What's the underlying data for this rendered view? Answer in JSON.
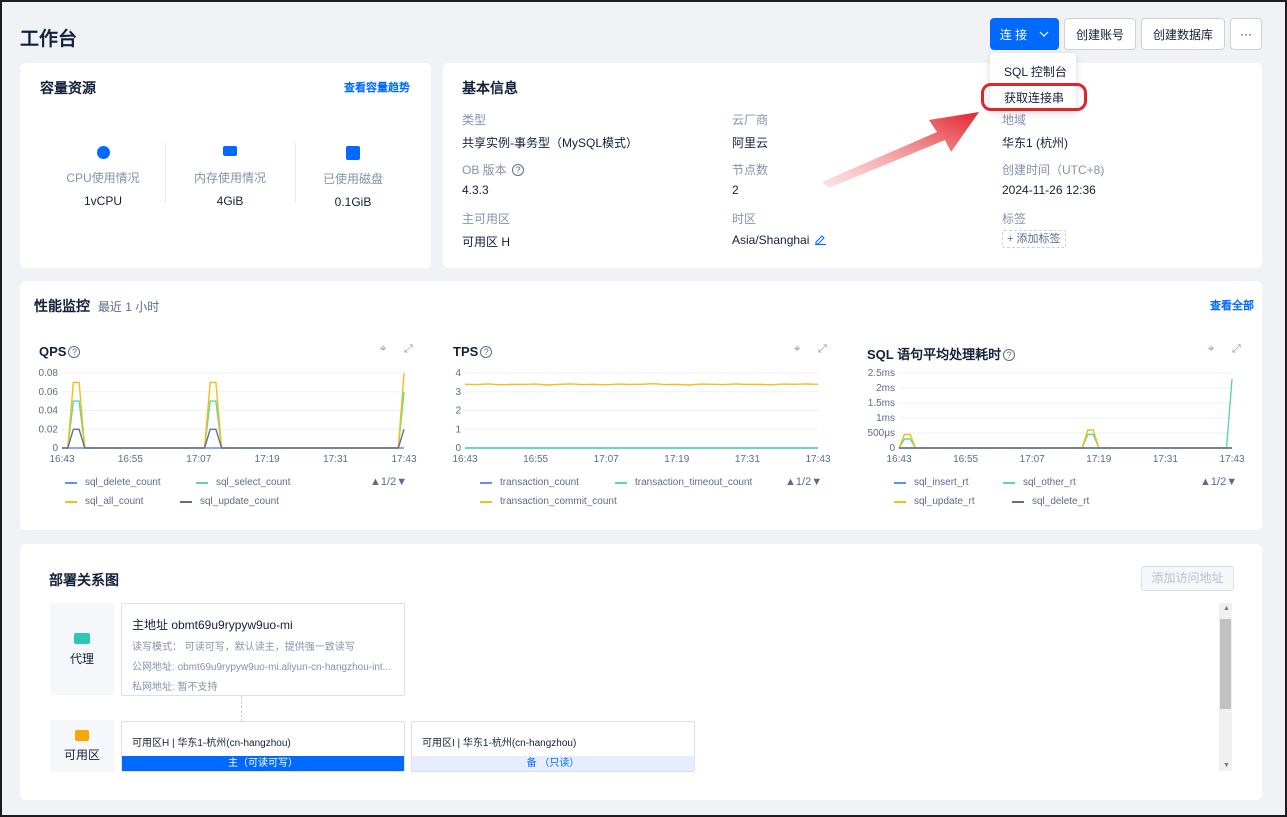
{
  "header": {
    "title": "工作台",
    "connect_label": "连 接",
    "create_account_label": "创建账号",
    "create_db_label": "创建数据库",
    "more_label": "···"
  },
  "connect_menu": {
    "items": [
      "SQL 控制台",
      "获取连接串"
    ]
  },
  "capacity": {
    "title": "容量资源",
    "trend_link": "查看容量趋势",
    "items": [
      {
        "label": "CPU使用情况",
        "value": "1vCPU",
        "icon": "cpu-icon"
      },
      {
        "label": "内存使用情况",
        "value": "4GiB",
        "icon": "memory-icon"
      },
      {
        "label": "已使用磁盘",
        "value": "0.1GiB",
        "icon": "disk-icon"
      }
    ]
  },
  "basic_info": {
    "title": "基本信息",
    "fields": [
      {
        "label": "类型",
        "value": "共享实例-事务型（MySQL模式）"
      },
      {
        "label": "云厂商",
        "value": "阿里云"
      },
      {
        "label": "地域",
        "value": "华东1 (杭州)"
      },
      {
        "label": "OB 版本",
        "value": "4.3.3"
      },
      {
        "label": "节点数",
        "value": "2"
      },
      {
        "label": "创建时间（UTC+8)",
        "value": "2024-11-26 12:36"
      },
      {
        "label": "主可用区",
        "value": "可用区 H"
      },
      {
        "label": "时区",
        "value": "Asia/Shanghai"
      },
      {
        "label": "标签",
        "value": "添加标签"
      }
    ]
  },
  "performance": {
    "title": "性能监控",
    "subtitle": "最近 1 小时",
    "view_all": "查看全部",
    "pager": "1/2"
  },
  "chart_data": [
    {
      "type": "line",
      "title": "QPS",
      "x_ticks": [
        "16:43",
        "16:55",
        "17:07",
        "17:19",
        "17:31",
        "17:43"
      ],
      "y_ticks": [
        "0",
        "0.02",
        "0.04",
        "0.06",
        "0.08"
      ],
      "ylim": [
        0,
        0.08
      ],
      "x": [
        0,
        1,
        2,
        3,
        4,
        5,
        6,
        7,
        8,
        9,
        10,
        11,
        12,
        13,
        14,
        15,
        16,
        17,
        18,
        19,
        20,
        21,
        22,
        23,
        24,
        25,
        26,
        27,
        28,
        29,
        30,
        31,
        32,
        33,
        34,
        35,
        36,
        37,
        38,
        39,
        40,
        41,
        42,
        43,
        44,
        45,
        46,
        47,
        48,
        49,
        50,
        51,
        52,
        53,
        54,
        55,
        56,
        57,
        58,
        59,
        60
      ],
      "series": [
        {
          "name": "sql_delete_count",
          "color": "#5b8ff9",
          "values": [
            0,
            0,
            0,
            0,
            0,
            0,
            0,
            0,
            0,
            0,
            0,
            0,
            0,
            0,
            0,
            0,
            0,
            0,
            0,
            0,
            0,
            0,
            0,
            0,
            0,
            0,
            0,
            0,
            0,
            0,
            0,
            0,
            0,
            0,
            0,
            0,
            0,
            0,
            0,
            0,
            0,
            0,
            0,
            0,
            0,
            0,
            0,
            0,
            0,
            0,
            0,
            0,
            0,
            0,
            0,
            0,
            0,
            0,
            0,
            0,
            0
          ]
        },
        {
          "name": "sql_select_count",
          "color": "#5ad8a6",
          "values": [
            0,
            0,
            0.05,
            0.05,
            0,
            0,
            0,
            0,
            0,
            0,
            0,
            0,
            0,
            0,
            0,
            0,
            0,
            0,
            0,
            0,
            0,
            0,
            0,
            0,
            0,
            0,
            0.05,
            0.05,
            0,
            0,
            0,
            0,
            0,
            0,
            0,
            0,
            0,
            0,
            0,
            0,
            0,
            0,
            0,
            0,
            0,
            0,
            0,
            0,
            0,
            0,
            0,
            0,
            0,
            0,
            0,
            0,
            0,
            0,
            0,
            0,
            0.06
          ]
        },
        {
          "name": "sql_all_count",
          "color": "#f6bd16",
          "values": [
            0,
            0,
            0.07,
            0.07,
            0,
            0,
            0,
            0,
            0,
            0,
            0,
            0,
            0,
            0,
            0,
            0,
            0,
            0,
            0,
            0,
            0,
            0,
            0,
            0,
            0,
            0,
            0.07,
            0.07,
            0,
            0,
            0,
            0,
            0,
            0,
            0,
            0,
            0,
            0,
            0,
            0,
            0,
            0,
            0,
            0,
            0,
            0,
            0,
            0,
            0,
            0,
            0,
            0,
            0,
            0,
            0,
            0,
            0,
            0,
            0,
            0,
            0.08
          ]
        },
        {
          "name": "sql_update_count",
          "color": "#5d7092",
          "values": [
            0,
            0,
            0.02,
            0.02,
            0,
            0,
            0,
            0,
            0,
            0,
            0,
            0,
            0,
            0,
            0,
            0,
            0,
            0,
            0,
            0,
            0,
            0,
            0,
            0,
            0,
            0,
            0.02,
            0.02,
            0,
            0,
            0,
            0,
            0,
            0,
            0,
            0,
            0,
            0,
            0,
            0,
            0,
            0,
            0,
            0,
            0,
            0,
            0,
            0,
            0,
            0,
            0,
            0,
            0,
            0,
            0,
            0,
            0,
            0,
            0,
            0,
            0.02
          ]
        }
      ]
    },
    {
      "type": "line",
      "title": "TPS",
      "x_ticks": [
        "16:43",
        "16:55",
        "17:07",
        "17:19",
        "17:31",
        "17:43"
      ],
      "y_ticks": [
        "0",
        "1",
        "2",
        "3",
        "4"
      ],
      "ylim": [
        0,
        4
      ],
      "x": [
        0,
        1,
        2,
        3,
        4,
        5,
        6,
        7,
        8,
        9,
        10,
        11,
        12,
        13,
        14,
        15,
        16,
        17,
        18,
        19,
        20,
        21,
        22,
        23,
        24,
        25,
        26,
        27,
        28,
        29,
        30
      ],
      "series": [
        {
          "name": "transaction_count",
          "color": "#5b8ff9",
          "values": [
            0,
            0,
            0,
            0,
            0,
            0,
            0,
            0,
            0,
            0,
            0,
            0,
            0,
            0,
            0,
            0,
            0,
            0,
            0,
            0,
            0,
            0,
            0,
            0,
            0,
            0,
            0,
            0,
            0,
            0,
            0
          ]
        },
        {
          "name": "transaction_timeout_count",
          "color": "#5ad8a6",
          "values": [
            0,
            0,
            0,
            0,
            0,
            0,
            0,
            0,
            0,
            0,
            0,
            0,
            0,
            0,
            0,
            0,
            0,
            0,
            0,
            0,
            0,
            0,
            0,
            0,
            0,
            0,
            0,
            0,
            0,
            0,
            0
          ]
        },
        {
          "name": "transaction_commit_count",
          "color": "#f6bd16",
          "values": [
            3.4,
            3.38,
            3.42,
            3.37,
            3.4,
            3.39,
            3.41,
            3.36,
            3.4,
            3.42,
            3.38,
            3.4,
            3.37,
            3.41,
            3.39,
            3.4,
            3.43,
            3.38,
            3.4,
            3.36,
            3.41,
            3.4,
            3.38,
            3.42,
            3.39,
            3.4,
            3.37,
            3.41,
            3.4,
            3.42,
            3.4
          ]
        }
      ]
    },
    {
      "type": "line",
      "title": "SQL 语句平均处理耗时",
      "x_ticks": [
        "16:43",
        "16:55",
        "17:07",
        "17:19",
        "17:31",
        "17:43"
      ],
      "y_ticks": [
        "0",
        "500μs",
        "1ms",
        "1.5ms",
        "2ms",
        "2.5ms"
      ],
      "ylim": [
        0,
        2.5
      ],
      "x": [
        0,
        1,
        2,
        3,
        4,
        5,
        6,
        7,
        8,
        9,
        10,
        11,
        12,
        13,
        14,
        15,
        16,
        17,
        18,
        19,
        20,
        21,
        22,
        23,
        24,
        25,
        26,
        27,
        28,
        29,
        30,
        31,
        32,
        33,
        34,
        35,
        36,
        37,
        38,
        39,
        40,
        41,
        42,
        43,
        44,
        45,
        46,
        47,
        48,
        49,
        50,
        51,
        52,
        53,
        54,
        55,
        56,
        57,
        58,
        59,
        60
      ],
      "series": [
        {
          "name": "sql_insert_rt",
          "color": "#5b8ff9",
          "values": [
            0,
            0,
            0,
            0,
            0,
            0,
            0,
            0,
            0,
            0,
            0,
            0,
            0,
            0,
            0,
            0,
            0,
            0,
            0,
            0,
            0,
            0,
            0,
            0,
            0,
            0,
            0,
            0,
            0,
            0,
            0,
            0,
            0,
            0,
            0,
            0,
            0,
            0,
            0,
            0,
            0,
            0,
            0,
            0,
            0,
            0,
            0,
            0,
            0,
            0,
            0,
            0,
            0,
            0,
            0,
            0,
            0,
            0,
            0,
            0,
            0
          ]
        },
        {
          "name": "sql_other_rt",
          "color": "#5ad8a6",
          "values": [
            0,
            0.3,
            0.3,
            0,
            0,
            0,
            0,
            0,
            0,
            0,
            0,
            0,
            0,
            0,
            0,
            0,
            0,
            0,
            0,
            0,
            0,
            0,
            0,
            0,
            0,
            0,
            0,
            0,
            0,
            0,
            0,
            0,
            0,
            0,
            0.45,
            0.45,
            0,
            0,
            0,
            0,
            0,
            0,
            0,
            0,
            0,
            0,
            0,
            0,
            0,
            0,
            0,
            0,
            0,
            0,
            0,
            0,
            0,
            0,
            0,
            0,
            2.3
          ]
        },
        {
          "name": "sql_update_rt",
          "color": "#f6bd16",
          "values": [
            0,
            0.45,
            0.45,
            0,
            0,
            0,
            0,
            0,
            0,
            0,
            0,
            0,
            0,
            0,
            0,
            0,
            0,
            0,
            0,
            0,
            0,
            0,
            0,
            0,
            0,
            0,
            0,
            0,
            0,
            0,
            0,
            0,
            0,
            0,
            0.6,
            0.6,
            0,
            0,
            0,
            0,
            0,
            0,
            0,
            0,
            0,
            0,
            0,
            0,
            0,
            0,
            0,
            0,
            0,
            0,
            0,
            0,
            0,
            0,
            0,
            0,
            0
          ]
        },
        {
          "name": "sql_delete_rt",
          "color": "#5d7092",
          "values": [
            0,
            0,
            0,
            0,
            0,
            0,
            0,
            0,
            0,
            0,
            0,
            0,
            0,
            0,
            0,
            0,
            0,
            0,
            0,
            0,
            0,
            0,
            0,
            0,
            0,
            0,
            0,
            0,
            0,
            0,
            0,
            0,
            0,
            0,
            0,
            0,
            0,
            0,
            0,
            0,
            0,
            0,
            0,
            0,
            0,
            0,
            0,
            0,
            0,
            0,
            0,
            0,
            0,
            0,
            0,
            0,
            0,
            0,
            0,
            0,
            0
          ]
        }
      ]
    }
  ],
  "deployment": {
    "title": "部署关系图",
    "add_access_label": "添加访问地址",
    "proxy_label": "代理",
    "zone_label": "可用区",
    "main_address": {
      "title": "主地址 obmt69u9rypyw9uo-mi",
      "rw_mode_label": "读写模式：",
      "rw_mode_value": "可读可写，默认读主，提供强一致读写",
      "public_label": "公网地址:",
      "public_value": "obmt69u9rypyw9uo-mi.aliyun-cn-hangzhou-int...",
      "private_label": "私网地址:",
      "private_value": "暂不支持"
    },
    "zones": [
      {
        "title": "可用区H | 华东1-杭州(cn-hangzhou)",
        "role": "主（可读可写）"
      },
      {
        "title": "可用区I | 华东1-杭州(cn-hangzhou)",
        "role": "备 （只读）"
      }
    ]
  }
}
